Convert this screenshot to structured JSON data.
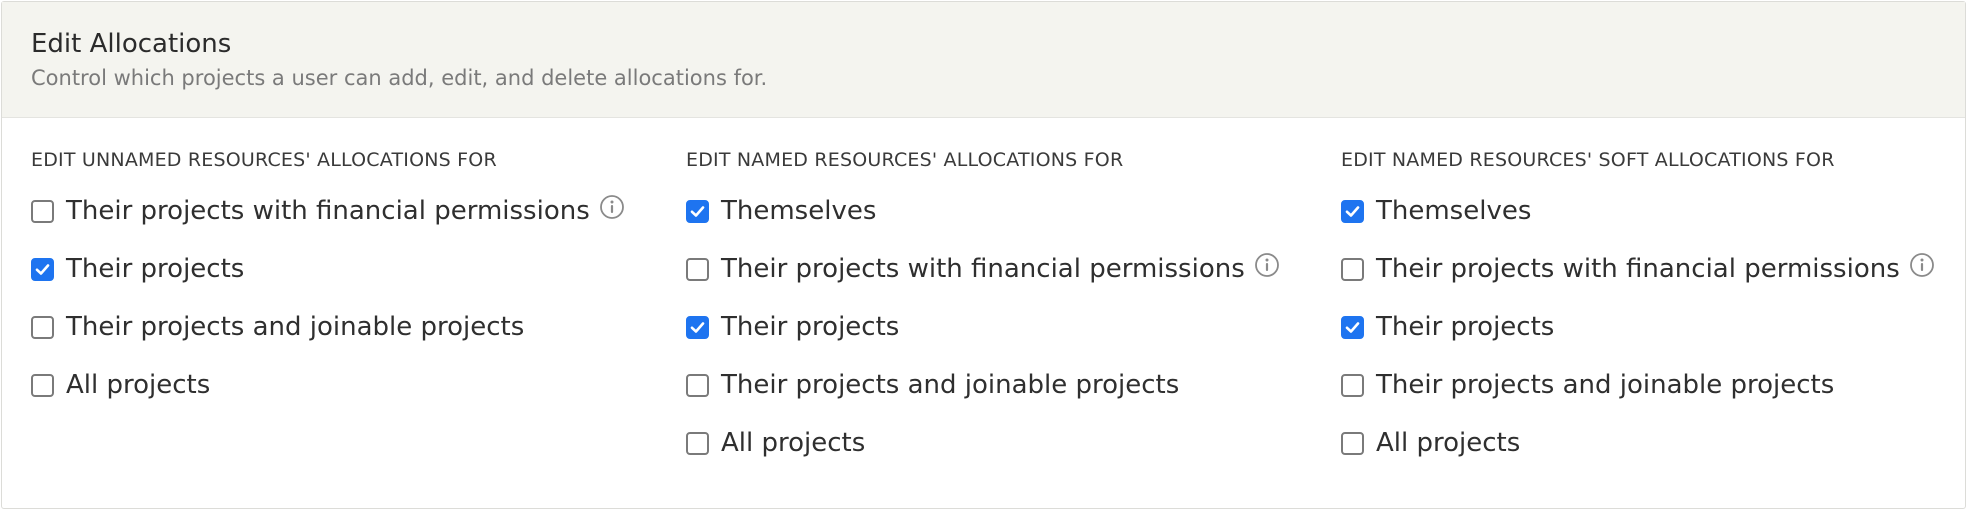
{
  "header": {
    "title": "Edit Allocations",
    "subtitle": "Control which projects a user can add, edit, and delete allocations for."
  },
  "colors": {
    "accent": "#1e74f0",
    "header_bg": "#f4f4ef"
  },
  "columns": [
    {
      "heading": "EDIT UNNAMED RESOURCES' ALLOCATIONS FOR",
      "options": [
        {
          "label": "Their projects with financial permissions",
          "checked": false,
          "info_icon": "info-icon"
        },
        {
          "label": "Their projects",
          "checked": true
        },
        {
          "label": "Their projects and joinable projects",
          "checked": false
        },
        {
          "label": "All projects",
          "checked": false
        }
      ]
    },
    {
      "heading": "EDIT NAMED RESOURCES' ALLOCATIONS FOR",
      "options": [
        {
          "label": "Themselves",
          "checked": true
        },
        {
          "label": "Their projects with financial permissions",
          "checked": false,
          "info_icon": "info-icon"
        },
        {
          "label": "Their projects",
          "checked": true
        },
        {
          "label": "Their projects and joinable projects",
          "checked": false
        },
        {
          "label": "All projects",
          "checked": false
        }
      ]
    },
    {
      "heading": "EDIT NAMED RESOURCES' SOFT ALLOCATIONS FOR",
      "options": [
        {
          "label": "Themselves",
          "checked": true
        },
        {
          "label": "Their projects with financial permissions",
          "checked": false,
          "info_icon": "info-icon"
        },
        {
          "label": "Their projects",
          "checked": true
        },
        {
          "label": "Their projects and joinable projects",
          "checked": false
        },
        {
          "label": "All projects",
          "checked": false
        }
      ]
    }
  ]
}
